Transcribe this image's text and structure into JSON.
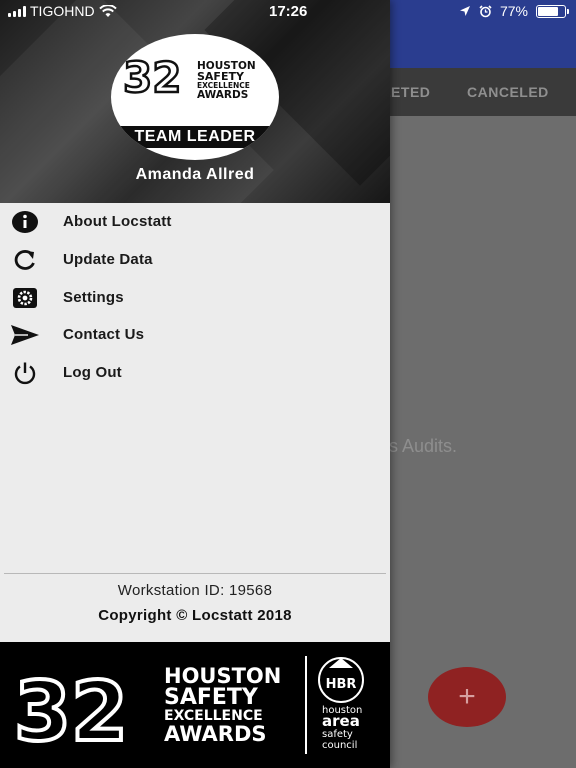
{
  "status_bar": {
    "carrier": "TIGOHND",
    "time": "17:26",
    "battery": "77%",
    "battery_level": 0.77
  },
  "background": {
    "tabs": [
      "LETED",
      "CANCELED"
    ],
    "empty_message": "ess Audits.",
    "fab_symbol": "+"
  },
  "drawer": {
    "logo": {
      "number": "32",
      "line1": "HOUSTON",
      "line2": "SAFETY",
      "line3": "EXCELLENCE",
      "line4": "AWARDS",
      "badge": "TEAM LEADER"
    },
    "user_name": "Amanda Allred",
    "menu": [
      {
        "label": "About Locstatt",
        "icon": "info-icon"
      },
      {
        "label": "Update Data",
        "icon": "refresh-icon"
      },
      {
        "label": "Settings",
        "icon": "gear-icon"
      },
      {
        "label": "Contact Us",
        "icon": "send-icon"
      },
      {
        "label": "Log Out",
        "icon": "power-icon"
      }
    ],
    "workstation": "Workstation ID: 19568",
    "copyright": "Copyright © Locstatt 2018",
    "footer": {
      "number": "32",
      "line1": "HOUSTON",
      "line2": "SAFETY",
      "line3": "EXCELLENCE",
      "line4": "AWARDS",
      "seal_text": "HBR",
      "org_lines": [
        "houston",
        "area",
        "safety",
        "council"
      ]
    }
  },
  "colors": {
    "header_blue": "#2a3d8f",
    "fab_red": "#8f2222",
    "drawer_bg": "#ececec"
  }
}
